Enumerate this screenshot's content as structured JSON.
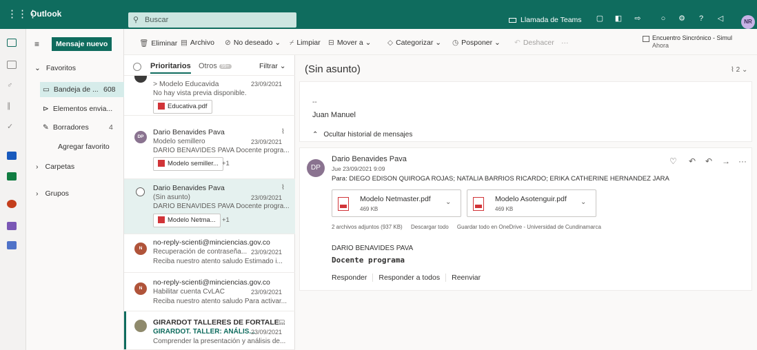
{
  "topbar": {
    "app_name": "Outlook",
    "search_placeholder": "Buscar",
    "teams_label": "Llamada de Teams",
    "user_initials": "NR",
    "icons": [
      "waffle-icon",
      "search-icon",
      "teams-cam-icon",
      "chat-icon",
      "onenote-icon",
      "todo-icon",
      "bell-icon",
      "gear-icon",
      "help-icon",
      "feedback-icon"
    ]
  },
  "nav": {
    "new_message": "Mensaje nuevo",
    "favoritos": "Favoritos",
    "inbox_label": "Bandeja de ...",
    "inbox_count": "608",
    "sent_label": "Elementos envia...",
    "drafts_label": "Borradores",
    "drafts_count": "4",
    "add_favorite": "Agregar favorito",
    "folders": "Carpetas",
    "groups": "Grupos"
  },
  "toolbar": {
    "delete": "Eliminar",
    "archive": "Archivo",
    "junk": "No deseado",
    "sweep": "Limpiar",
    "move": "Mover a",
    "categorize": "Categorizar",
    "postpone": "Posponer",
    "undo": "Deshacer",
    "more": "···",
    "event_title": "Encuentro Sincrónico - Simul",
    "event_time": "Ahora"
  },
  "list": {
    "focused": "Prioritarios",
    "other": "Otros",
    "other_badge": "99+",
    "filter": "Filtrar",
    "messages": [
      {
        "from": "> Modelo Educavida",
        "date": "23/09/2021",
        "preview": "No hay vista previa disponible.",
        "attachment": "Educativa.pdf"
      },
      {
        "initials": "DP",
        "from": "Dario Benavides Pava",
        "subject": "Modelo semillero",
        "date": "23/09/2021",
        "preview": "DARIO BENAVIDES PAVA Docente progra...",
        "attachment": "Modelo semiller...",
        "more": "+1"
      },
      {
        "from": "Dario Benavides Pava",
        "subject": "(Sin asunto)",
        "date": "23/09/2021",
        "preview": "DARIO BENAVIDES PAVA Docente progra...",
        "attachment": "Modelo Netma...",
        "more": "+1"
      },
      {
        "initials": "N",
        "from": "no-reply-scienti@minciencias.gov.co",
        "subject": "Recuperación de contraseña...",
        "date": "23/09/2021",
        "preview": "Reciba nuestro atento saludo Estimado i..."
      },
      {
        "initials": "N",
        "from": "no-reply-scienti@minciencias.gov.co",
        "subject": "Habilitar cuenta CvLAC",
        "date": "23/09/2021",
        "preview": "Reciba nuestro atento saludo Para activar..."
      },
      {
        "from": "GIRARDOT TALLERES DE FORTALE...",
        "subject": "GIRARDOT. TALLER: ANÁLIS...",
        "date": "23/09/2021",
        "preview": "Comprender la presentación y análisis de..."
      }
    ]
  },
  "reading": {
    "title": "(Sin asunto)",
    "count": "2",
    "prev_dashes": "--",
    "prev_signature": "Juan Manuel",
    "hide_history": "Ocultar historial de mensajes",
    "sender": "Dario Benavides Pava",
    "initials": "DP",
    "date": "Jue 23/09/2021 9:09",
    "to": "Para:  DIEGO EDISON QUIROGA ROJAS; NATALIA BARRIOS RICARDO; ERIKA CATHERINE HERNANDEZ JARA",
    "attachments": [
      {
        "name": "Modelo Netmaster.pdf",
        "size": "469 KB"
      },
      {
        "name": "Modelo Asotenguir.pdf",
        "size": "469 KB"
      }
    ],
    "att_summary": "2 archivos adjuntos (937 KB)",
    "download_all": "Descargar todo",
    "save_onedrive": "Guardar todo en OneDrive - Universidad de Cundinamarca",
    "body_name": "DARIO BENAVIDES PAVA",
    "body_role": "Docente programa",
    "reply": "Responder",
    "reply_all": "Responder a todos",
    "forward": "Reenviar"
  },
  "colors": {
    "brand": "#0f6c5e",
    "selected": "#d6ecea",
    "pdf_red": "#d13438"
  }
}
